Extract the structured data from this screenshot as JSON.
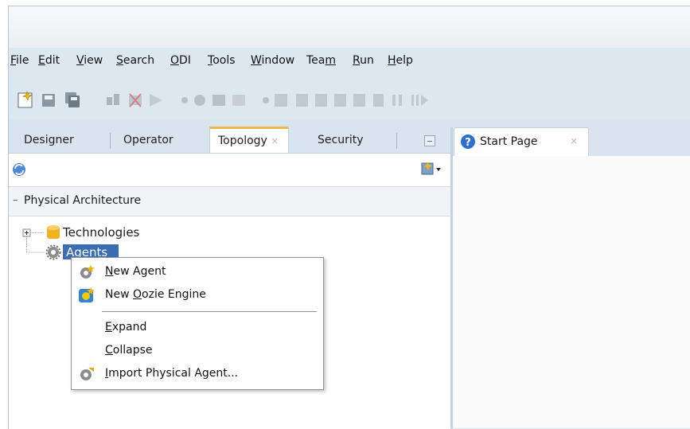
{
  "menubar": {
    "items": [
      {
        "pre": "",
        "u": "F",
        "post": "ile"
      },
      {
        "pre": "",
        "u": "E",
        "post": "dit"
      },
      {
        "pre": "",
        "u": "V",
        "post": "iew"
      },
      {
        "pre": "",
        "u": "S",
        "post": "earch"
      },
      {
        "pre": "",
        "u": "O",
        "post": "DI"
      },
      {
        "pre": "",
        "u": "T",
        "post": "ools"
      },
      {
        "pre": "",
        "u": "W",
        "post": "indow"
      },
      {
        "pre": "Tea",
        "u": "m",
        "post": ""
      },
      {
        "pre": "",
        "u": "R",
        "post": "un"
      },
      {
        "pre": "",
        "u": "H",
        "post": "elp"
      }
    ]
  },
  "toolbar": {
    "icons": [
      "new-icon",
      "save-icon",
      "save-all-icon",
      "generate-icon",
      "delete-icon",
      "run-icon",
      "stop-icon",
      "debug-icon",
      "step-icon",
      "wand-icon",
      "arrow-icon",
      "breakpoint-icon",
      "step-into-icon",
      "step-over-icon",
      "step-out-icon",
      "step-return-icon",
      "end-icon",
      "pause-icon",
      "resume-icon"
    ]
  },
  "left_tabs": {
    "designer": "Designer",
    "operator": "Operator",
    "topology": "Topology",
    "security": "Security",
    "close": "×"
  },
  "right_tabs": {
    "start_page": "Start Page",
    "close": "×"
  },
  "section": {
    "toggle": "–",
    "title": "Physical Architecture"
  },
  "tree": {
    "technologies": "Technologies",
    "agents": "Agents",
    "expander": "+"
  },
  "context_menu": {
    "new_agent": {
      "pre": "",
      "u": "N",
      "post": "ew Agent"
    },
    "new_oozie": {
      "pre": "New ",
      "u": "O",
      "post": "ozie Engine"
    },
    "expand": {
      "pre": "",
      "u": "E",
      "post": "xpand"
    },
    "collapse": {
      "pre": "",
      "u": "C",
      "post": "ollapse"
    },
    "import": {
      "pre": "",
      "u": "I",
      "post": "mport Physical Agent..."
    }
  },
  "colors": {
    "accent_tab": "#f0b84b",
    "selection": "#3b6db3",
    "chrome": "#d9e4ee"
  }
}
